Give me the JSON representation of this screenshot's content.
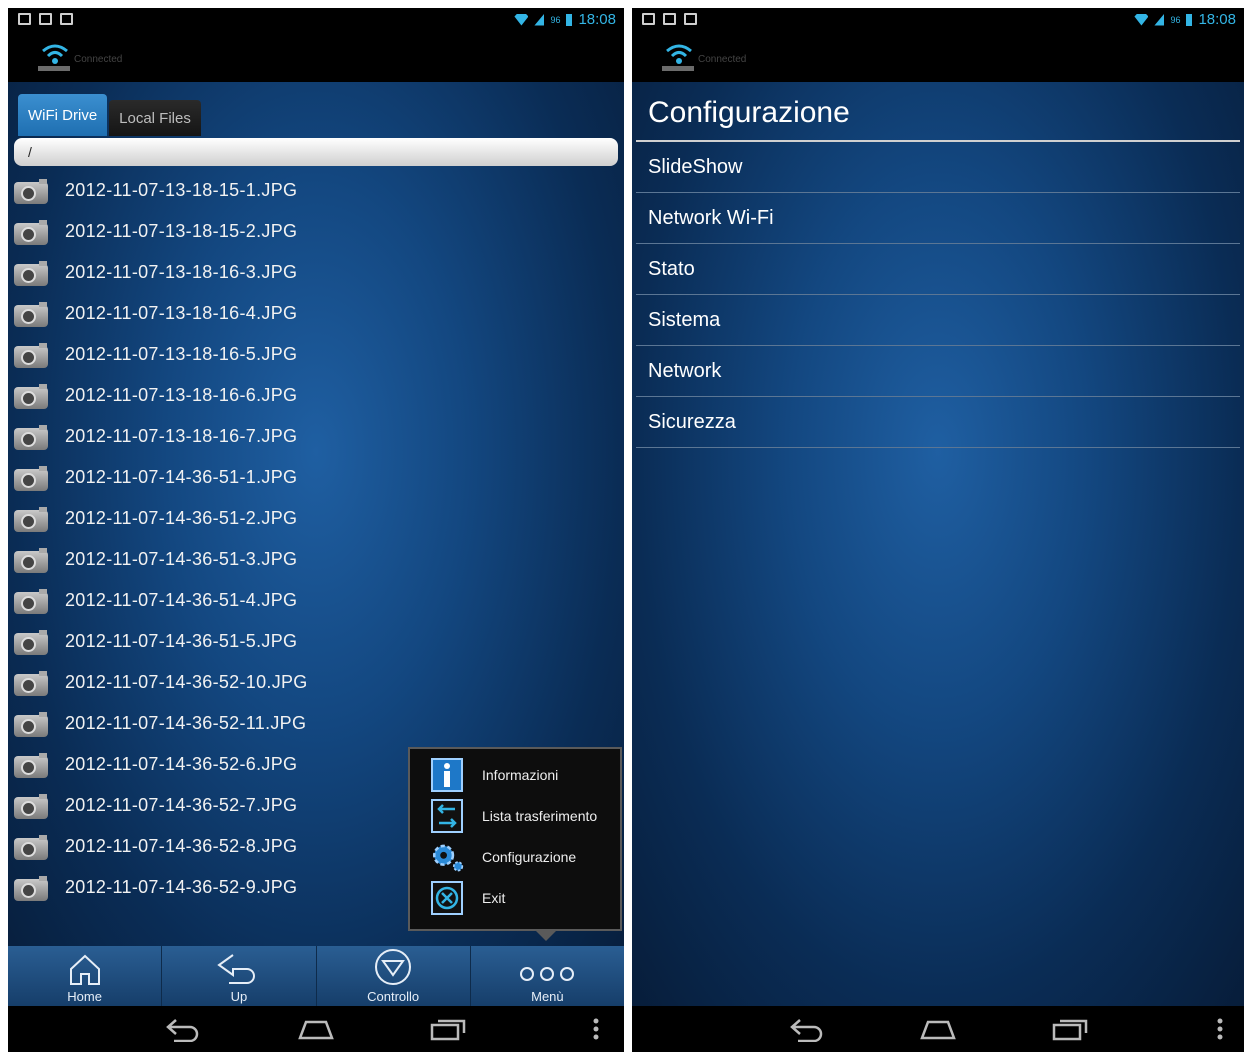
{
  "left_screen": {
    "status": {
      "time": "18:08",
      "battery": "96"
    },
    "notification": {
      "text": "Connected"
    },
    "tabs": [
      {
        "label": "WiFi Drive"
      },
      {
        "label": "Local Files"
      }
    ],
    "path": "/",
    "files": [
      "2012-11-07-13-18-15-1.JPG",
      "2012-11-07-13-18-15-2.JPG",
      "2012-11-07-13-18-16-3.JPG",
      "2012-11-07-13-18-16-4.JPG",
      "2012-11-07-13-18-16-5.JPG",
      "2012-11-07-13-18-16-6.JPG",
      "2012-11-07-13-18-16-7.JPG",
      "2012-11-07-14-36-51-1.JPG",
      "2012-11-07-14-36-51-2.JPG",
      "2012-11-07-14-36-51-3.JPG",
      "2012-11-07-14-36-51-4.JPG",
      "2012-11-07-14-36-51-5.JPG",
      "2012-11-07-14-36-52-10.JPG",
      "2012-11-07-14-36-52-11.JPG",
      "2012-11-07-14-36-52-6.JPG",
      "2012-11-07-14-36-52-7.JPG",
      "2012-11-07-14-36-52-8.JPG",
      "2012-11-07-14-36-52-9.JPG"
    ],
    "popup_menu": [
      {
        "label": "Informazioni",
        "icon": "info-icon"
      },
      {
        "label": "Lista trasferimento",
        "icon": "transfer-icon"
      },
      {
        "label": "Configurazione",
        "icon": "gear-icon"
      },
      {
        "label": "Exit",
        "icon": "close-icon"
      }
    ],
    "toolbar": [
      {
        "label": "Home",
        "icon": "home-icon"
      },
      {
        "label": "Up",
        "icon": "back-arrow-icon"
      },
      {
        "label": "Controllo",
        "icon": "control-icon"
      },
      {
        "label": "Menù",
        "icon": "more-icon"
      }
    ]
  },
  "right_screen": {
    "status": {
      "time": "18:08",
      "battery": "96"
    },
    "notification": {
      "text": "Connected"
    },
    "title": "Configurazione",
    "items": [
      "SlideShow",
      "Network Wi-Fi",
      "Stato",
      "Sistema",
      "Network",
      "Sicurezza"
    ]
  },
  "colors": {
    "accent": "#33b5e5",
    "background_blue": "#134780",
    "toolbar": "#2a5e93"
  }
}
